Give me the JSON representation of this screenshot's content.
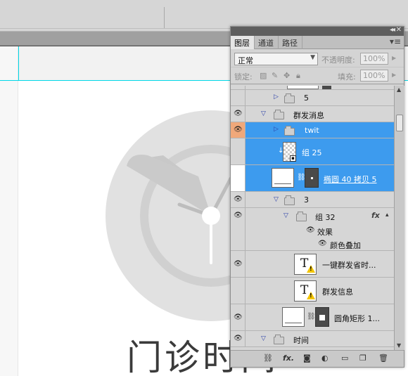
{
  "panel": {
    "tabs": [
      {
        "label": "图层",
        "active": true
      },
      {
        "label": "通道",
        "active": false
      },
      {
        "label": "路径",
        "active": false
      }
    ],
    "blend_mode": "正常",
    "opacity_label": "不透明度:",
    "opacity_value": "100%",
    "lock_label": "锁定:",
    "fill_label": "填充:",
    "fill_value": "100%"
  },
  "layers": [
    {
      "name": "5",
      "type": "group"
    },
    {
      "name": "群发消息",
      "type": "group"
    },
    {
      "name": "twit",
      "type": "group",
      "selected": true
    },
    {
      "name": "组 25",
      "type": "smart",
      "selected": true
    },
    {
      "name": "椭圆 40 拷贝 5",
      "type": "shape",
      "selected": true
    },
    {
      "name": "3",
      "type": "group"
    },
    {
      "name": "组 32",
      "type": "group",
      "fx": "fx"
    },
    {
      "name": "效果",
      "type": "effect"
    },
    {
      "name": "颜色叠加",
      "type": "effect-item"
    },
    {
      "name": "一键群发省时...",
      "type": "text"
    },
    {
      "name": "群发信息",
      "type": "text"
    },
    {
      "name": "圆角矩形 1...",
      "type": "shape"
    },
    {
      "name": "时间",
      "type": "group"
    }
  ],
  "canvas": {
    "headline": "门诊时间",
    "colors": {
      "guide": "#00d8e8",
      "selection": "#3d9bee",
      "highlight": "#f0a87a"
    }
  }
}
